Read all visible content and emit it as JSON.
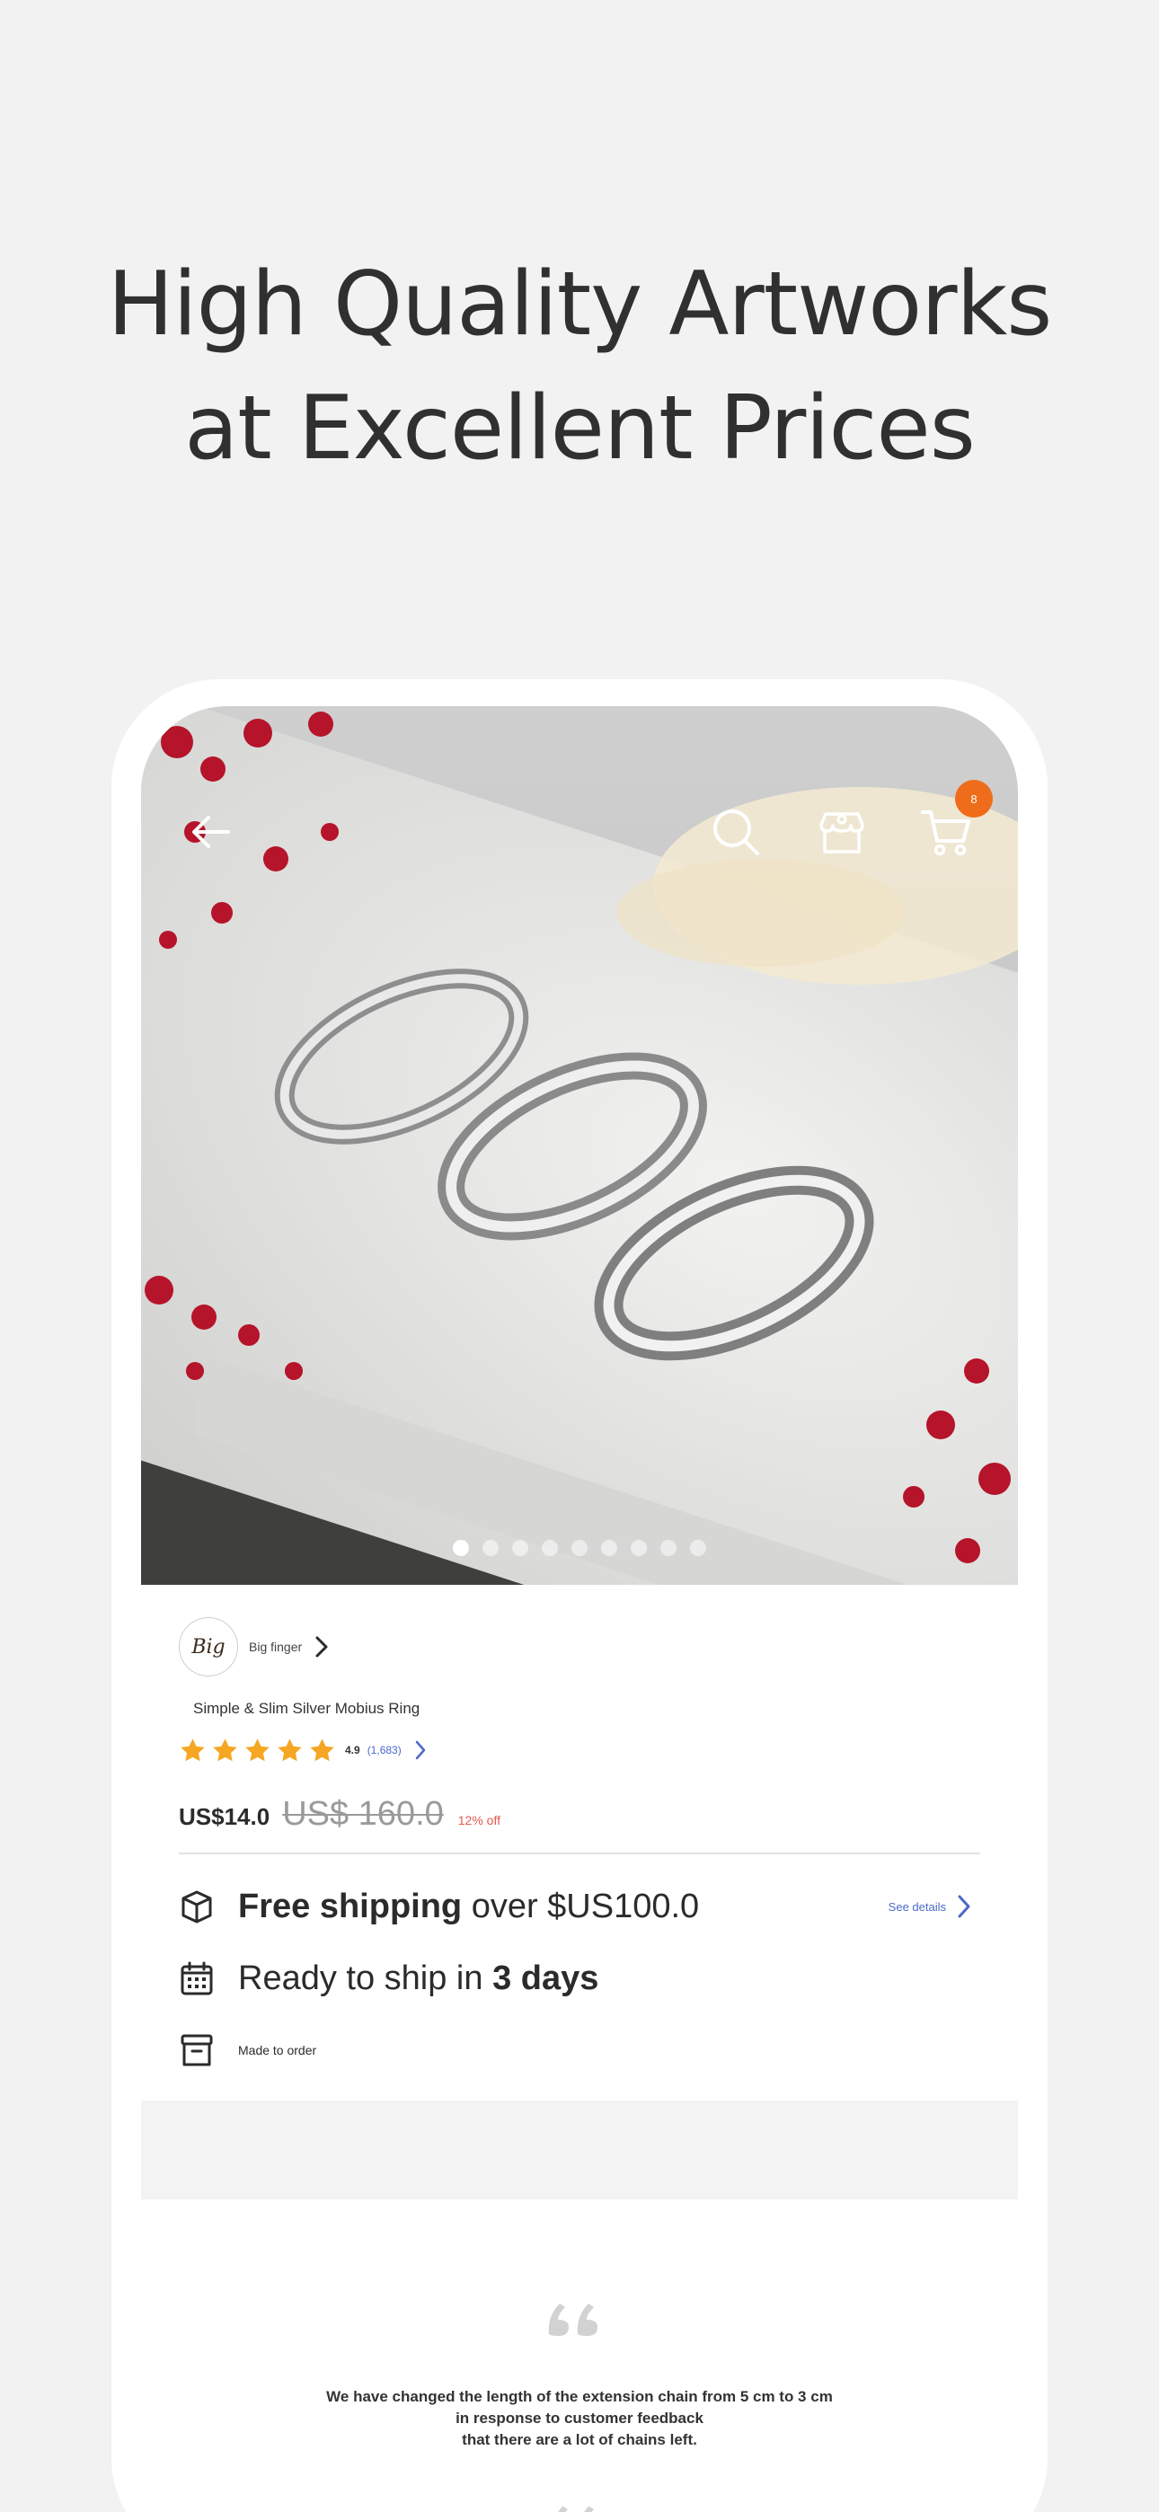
{
  "headline": {
    "line1": "High Quality Artworks",
    "line2": "at Excellent Prices"
  },
  "product_screen": {
    "image": {
      "description_icon": "ring-photo",
      "carousel_dot_count": 9,
      "active_dot_index": 0
    },
    "top_bar": {
      "back_icon": "arrow-left-icon",
      "search_icon": "search-icon",
      "shop_icon": "shop-icon",
      "cart_icon": "cart-icon",
      "cart_badge": "8"
    },
    "shop": {
      "avatar_text": "Big",
      "name": "Big finger"
    },
    "product": {
      "name": "Simple & Slim Silver Mobius Ring",
      "rating": 5,
      "rating_value": "4.9",
      "rating_count": "(1,683)",
      "price": "US$14.0",
      "original_price": "US$ 160.0",
      "discount": "12% off"
    },
    "features": {
      "shipping_bold": "Free shipping",
      "shipping_rest": " over $US100.0",
      "see_details": "See details",
      "ready_prefix": "Ready to ship in ",
      "ready_bold": "3 days",
      "made_to_order": "Made to order"
    },
    "review": {
      "line1": "We have changed the length of the extension chain from 5 cm to 3 cm",
      "line2": "in response to customer feedback",
      "line3": "that there are a lot of chains left."
    }
  },
  "colors": {
    "background": "#f2f2f2",
    "accent_orange": "#ef6c1a",
    "star": "#f5a623",
    "link_blue": "#4d68c8",
    "discount_red": "#e4574f"
  }
}
